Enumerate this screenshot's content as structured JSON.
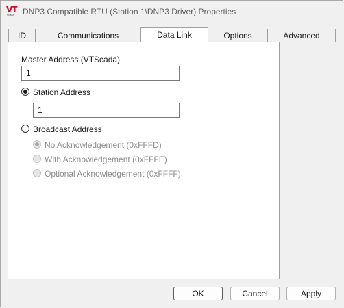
{
  "window": {
    "title": "DNP3 Compatible RTU (Station 1\\DNP3 Driver) Properties",
    "logo_text": "VT",
    "logo_subtext": "scada"
  },
  "tabs": [
    {
      "label": "ID",
      "active": false
    },
    {
      "label": "Communications",
      "active": false
    },
    {
      "label": "Data Link",
      "active": true
    },
    {
      "label": "Options",
      "active": false
    },
    {
      "label": "Advanced",
      "active": false
    }
  ],
  "datalink": {
    "master_address_label": "Master Address (VTScada)",
    "master_address_value": "1",
    "station_address_label": "Station Address",
    "station_address_selected": true,
    "station_address_value": "1",
    "broadcast_address_label": "Broadcast Address",
    "broadcast_address_selected": false,
    "broadcast_options": [
      {
        "label": "No Acknowledgement (0xFFFD)",
        "selected": true,
        "enabled": false
      },
      {
        "label": "With Acknowledgement (0xFFFE)",
        "selected": false,
        "enabled": false
      },
      {
        "label": "Optional Acknowledgement (0xFFFF)",
        "selected": false,
        "enabled": false
      }
    ]
  },
  "buttons": {
    "ok": "OK",
    "cancel": "Cancel",
    "apply": "Apply"
  }
}
